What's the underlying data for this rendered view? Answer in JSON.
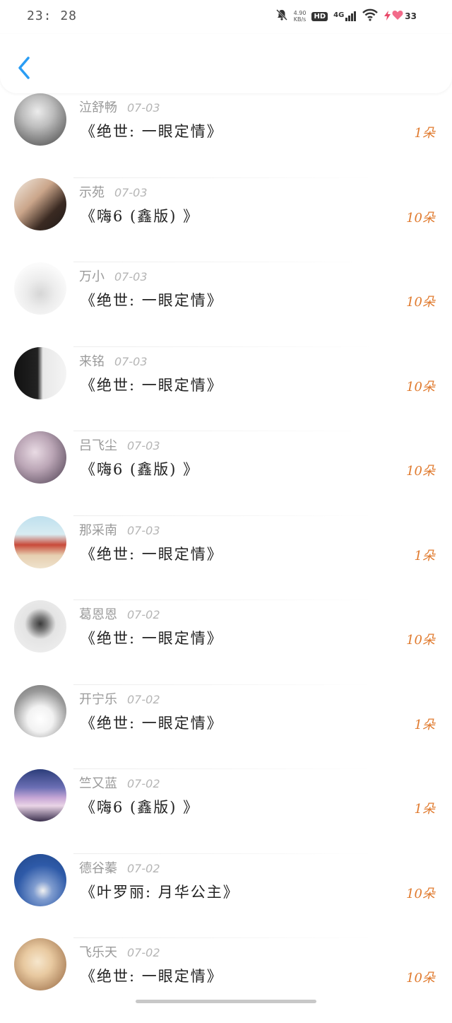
{
  "status_bar": {
    "time": "23: 28",
    "net_speed_value": "4.90",
    "net_speed_unit": "KB/s",
    "hd_label": "HD",
    "network_label": "4G",
    "battery_level": "33"
  },
  "colors": {
    "accent_back": "#2a9df4",
    "count_orange": "#e07a2e",
    "name_gray": "#9a9a9a"
  },
  "gifts": [
    {
      "name": "泣舒畅",
      "date": "07-03",
      "item": "《绝世: 一眼定情》",
      "count": "1朵"
    },
    {
      "name": "示苑",
      "date": "07-03",
      "item": "《嗨6 (鑫版) 》",
      "count": "10朵"
    },
    {
      "name": "万小",
      "date": "07-03",
      "item": "《绝世: 一眼定情》",
      "count": "10朵"
    },
    {
      "name": "来铭",
      "date": "07-03",
      "item": "《绝世: 一眼定情》",
      "count": "10朵"
    },
    {
      "name": "吕飞尘",
      "date": "07-03",
      "item": "《嗨6 (鑫版) 》",
      "count": "10朵"
    },
    {
      "name": "那采南",
      "date": "07-03",
      "item": "《绝世: 一眼定情》",
      "count": "1朵"
    },
    {
      "name": "葛恩恩",
      "date": "07-02",
      "item": "《绝世: 一眼定情》",
      "count": "10朵"
    },
    {
      "name": "开宁乐",
      "date": "07-02",
      "item": "《绝世: 一眼定情》",
      "count": "1朵"
    },
    {
      "name": "竺又蓝",
      "date": "07-02",
      "item": "《嗨6 (鑫版) 》",
      "count": "1朵"
    },
    {
      "name": "德谷蓁",
      "date": "07-02",
      "item": "《叶罗丽: 月华公主》",
      "count": "10朵"
    },
    {
      "name": "飞乐天",
      "date": "07-02",
      "item": "《绝世: 一眼定情》",
      "count": "10朵"
    }
  ]
}
